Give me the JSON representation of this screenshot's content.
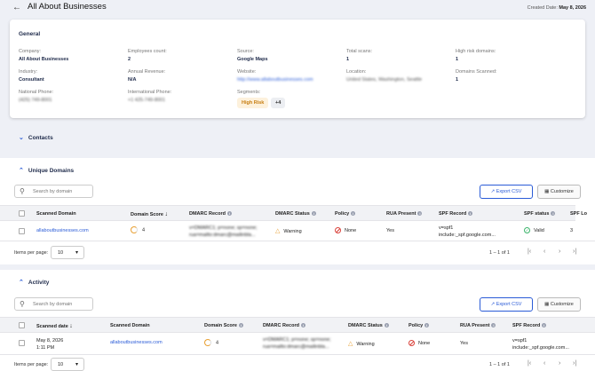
{
  "header": {
    "back_icon": "arrow-left-icon",
    "title": "All About Businesses",
    "created_label": "Created Date:",
    "created_value": "May 8, 2026"
  },
  "general": {
    "title": "General",
    "company": {
      "label": "Company:",
      "value": "All About Businesses"
    },
    "employees": {
      "label": "Employees count:",
      "value": "2"
    },
    "source": {
      "label": "Source:",
      "value": "Google Maps"
    },
    "total_scans": {
      "label": "Total scans:",
      "value": "1"
    },
    "high_risk_domains": {
      "label": "High risk domains:",
      "value": "1"
    },
    "industry": {
      "label": "Industry:",
      "value": "Consultant"
    },
    "annual_revenue": {
      "label": "Annual Revenue:",
      "value": "N/A"
    },
    "website": {
      "label": "Website:",
      "value": "http://www.allaboutbusinesses.com"
    },
    "location": {
      "label": "Location:",
      "value": "United States, Washington, Seattle"
    },
    "domains_scanned": {
      "label": "Domains Scanned:",
      "value": "1"
    },
    "national_phone": {
      "label": "National Phone:",
      "value": "(425) 749-8001"
    },
    "international_phone": {
      "label": "International Phone:",
      "value": "+1 425-749-8001"
    },
    "segments": {
      "label": "Segments:",
      "chip": "High Risk",
      "more": "+4"
    }
  },
  "contacts": {
    "title": "Contacts"
  },
  "unique_domains": {
    "title": "Unique Domains",
    "search_placeholder": "Search by domain",
    "export_label": "Export CSV",
    "customize_label": "Customize",
    "columns": [
      "Scanned Domain",
      "Domain Score",
      "DMARC Record",
      "DMARC Status",
      "Policy",
      "RUA Present",
      "SPF Record",
      "SPF status",
      "SPF Lo"
    ],
    "row": {
      "domain": "allaboutbusinesses.com",
      "score": "4",
      "dmarc_record_1": "v=DMARC1; p=none; sp=none;",
      "dmarc_record_2": "rua=mailto:dmarc@mailinbla...",
      "dmarc_status": "Warning",
      "policy": "None",
      "rua": "Yes",
      "spf_record_1": "v=spf1",
      "spf_record_2": "include:_spf.google.com...",
      "spf_status": "Valid",
      "spf_lookups": "3"
    },
    "items_per_page_label": "Items per page:",
    "items_per_page": "10",
    "range": "1 – 1 of 1"
  },
  "activity": {
    "title": "Activity",
    "search_placeholder": "Search by domain",
    "export_label": "Export CSV",
    "customize_label": "Customize",
    "columns": [
      "Scanned date",
      "Scanned Domain",
      "Domain Score",
      "DMARC Record",
      "DMARC Status",
      "Policy",
      "RUA Present",
      "SPF Record"
    ],
    "row": {
      "date": "May 8, 2026",
      "time": "1:11 PM",
      "domain": "allaboutbusinesses.com",
      "score": "4",
      "dmarc_record_1": "v=DMARC1; p=none; sp=none;",
      "dmarc_record_2": "rua=mailto:dmarc@mailinbla...",
      "dmarc_status": "Warning",
      "policy": "None",
      "rua": "Yes",
      "spf_record_1": "v=spf1",
      "spf_record_2": "include:_spf.google.com..."
    },
    "items_per_page_label": "Items per page:",
    "items_per_page": "10",
    "range": "1 – 1 of 1"
  },
  "colors": {
    "accent": "#2a5bd7",
    "warning": "#e8a033",
    "danger": "#d9413a",
    "success": "#3bb46b",
    "chip_bg": "#fdf1dc"
  }
}
